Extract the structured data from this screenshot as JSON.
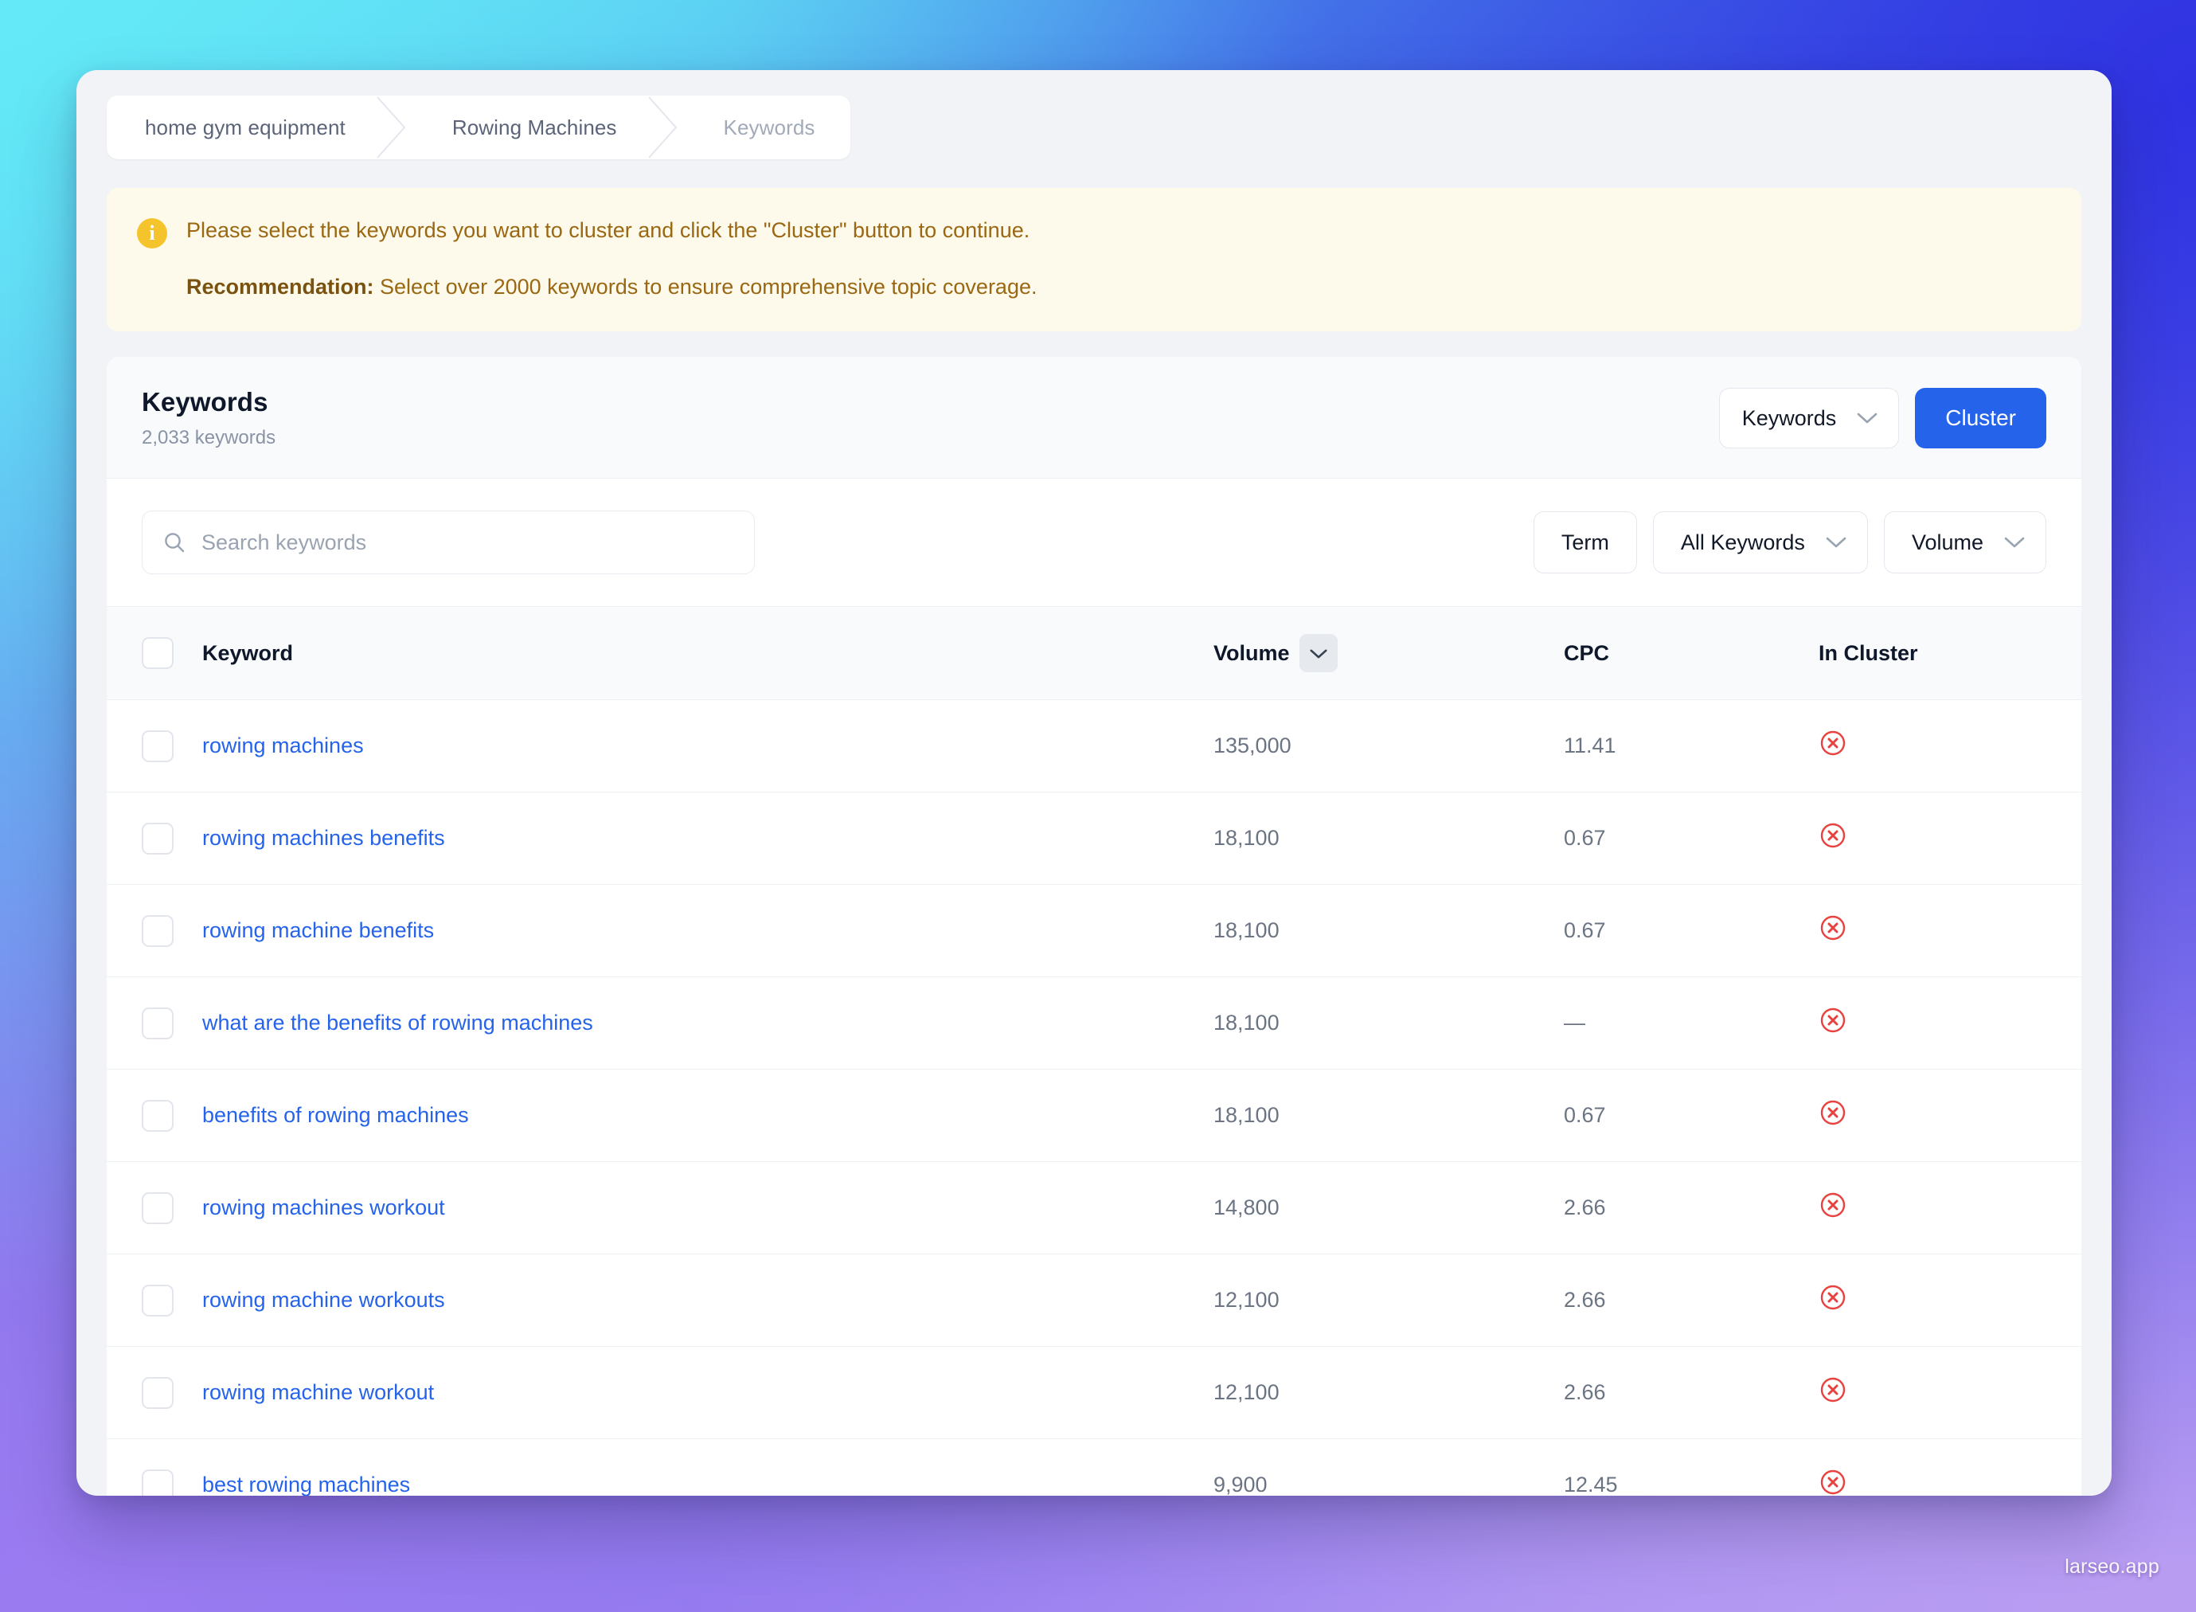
{
  "breadcrumb": {
    "items": [
      {
        "label": "home gym equipment",
        "current": false
      },
      {
        "label": "Rowing Machines",
        "current": false
      },
      {
        "label": "Keywords",
        "current": true
      }
    ]
  },
  "alert": {
    "icon": "info-icon",
    "icon_glyph": "i",
    "message": "Please select the keywords you want to cluster and click the \"Cluster\" button to continue.",
    "recommendation_label": "Recommendation:",
    "recommendation_text": " Select over 2000 keywords to ensure comprehensive topic coverage."
  },
  "panel": {
    "title": "Keywords",
    "subtitle": "2,033 keywords",
    "view_select": "Keywords",
    "cluster_button": "Cluster"
  },
  "search": {
    "placeholder": "Search keywords",
    "value": ""
  },
  "filters": {
    "term_button": "Term",
    "scope_select": "All Keywords",
    "sort_select": "Volume"
  },
  "table": {
    "columns": {
      "keyword": "Keyword",
      "volume": "Volume",
      "cpc": "CPC",
      "in_cluster": "In Cluster"
    },
    "rows": [
      {
        "keyword": "rowing machines",
        "volume": "135,000",
        "cpc": "11.41",
        "in_cluster": "no"
      },
      {
        "keyword": "rowing machines benefits",
        "volume": "18,100",
        "cpc": "0.67",
        "in_cluster": "no"
      },
      {
        "keyword": "rowing machine benefits",
        "volume": "18,100",
        "cpc": "0.67",
        "in_cluster": "no"
      },
      {
        "keyword": "what are the benefits of rowing machines",
        "volume": "18,100",
        "cpc": "—",
        "in_cluster": "no"
      },
      {
        "keyword": "benefits of rowing machines",
        "volume": "18,100",
        "cpc": "0.67",
        "in_cluster": "no"
      },
      {
        "keyword": "rowing machines workout",
        "volume": "14,800",
        "cpc": "2.66",
        "in_cluster": "no"
      },
      {
        "keyword": "rowing machine workouts",
        "volume": "12,100",
        "cpc": "2.66",
        "in_cluster": "no"
      },
      {
        "keyword": "rowing machine workout",
        "volume": "12,100",
        "cpc": "2.66",
        "in_cluster": "no"
      },
      {
        "keyword": "best rowing machines",
        "volume": "9,900",
        "cpc": "12.45",
        "in_cluster": "no"
      }
    ]
  },
  "watermark": "larseo.app",
  "colors": {
    "accent": "#2563eb",
    "link": "#2563eb",
    "alert_bg": "#fdfaeb",
    "alert_text": "#9a6712",
    "alert_icon": "#f5c32c",
    "danger": "#e8423f",
    "panel_bg": "#ffffff",
    "window_bg": "#f1f3f6"
  }
}
